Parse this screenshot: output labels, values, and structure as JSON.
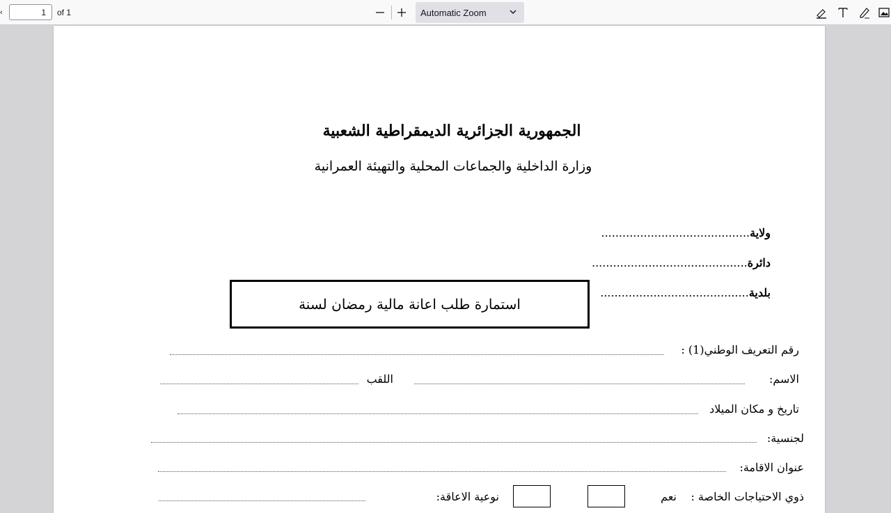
{
  "toolbar": {
    "edge_glyph": "‹",
    "page_number": "1",
    "page_count": "of 1",
    "zoom_value": "Automatic Zoom"
  },
  "document": {
    "title": "الجمهورية الجزائرية الديمقراطية الشعبية",
    "subtitle": "وزارة الداخلية والجماعات المحلية والتهيئة العمرانية",
    "admin": {
      "wilaya": "ولاية",
      "daira": "دائرة",
      "baladia": "بلدية"
    },
    "form_title": "استمارة طلب اعانة مالية رمضان لسنة",
    "fields": {
      "national_id": "رقم التعريف الوطني(1) :",
      "first_name": "الاسم:",
      "last_name": "اللقب",
      "birth": "تاريخ و مكان الميلاد",
      "nationality": "لجنسية:",
      "address": "عنوان الاقامة:",
      "special_needs": "ذوي الاحتياجات الخاصة :",
      "yes": "نعم",
      "disability_type": "نوعية الاعاقة:"
    }
  }
}
